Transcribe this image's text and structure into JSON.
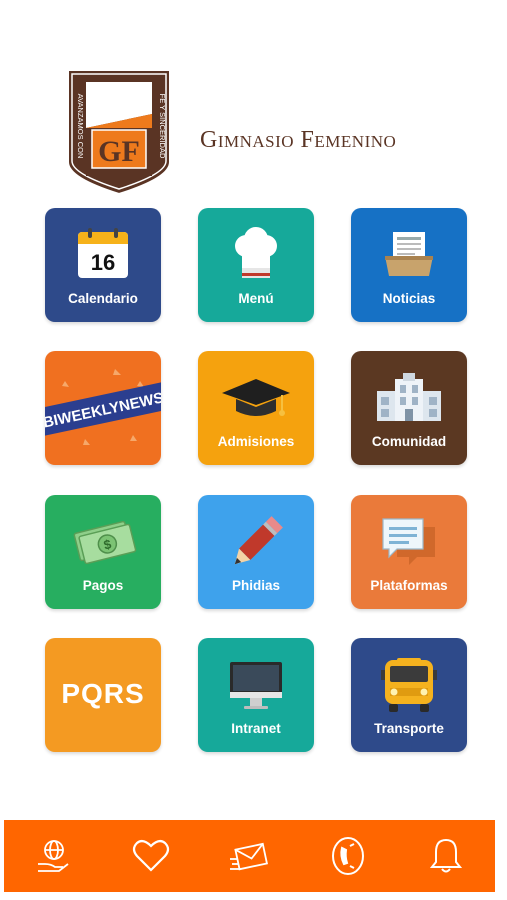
{
  "header": {
    "crest_left": "AVANZAMOS CON",
    "crest_right": "FE Y SINCERIDAD",
    "crest_monogram": "GF",
    "school_name": "Gimnasio Femenino"
  },
  "tiles": [
    {
      "label": "Calendario",
      "color": "#2e4a8a",
      "icon": "calendar-icon",
      "date": "16"
    },
    {
      "label": "Menú",
      "color": "#16a99a",
      "icon": "chef-hat-icon"
    },
    {
      "label": "Noticias",
      "color": "#1671c5",
      "icon": "news-tray-icon"
    },
    {
      "label": "BIWEEKLYNEWS",
      "color": "#f07020",
      "icon": "biweekly-news-banner"
    },
    {
      "label": "Admisiones",
      "color": "#f5a20e",
      "icon": "graduation-cap-icon"
    },
    {
      "label": "Comunidad",
      "color": "#5b3822",
      "icon": "building-icon"
    },
    {
      "label": "Pagos",
      "color": "#27ae60",
      "icon": "money-icon"
    },
    {
      "label": "Phidias",
      "color": "#3ea2ec",
      "icon": "pencil-icon"
    },
    {
      "label": "Plataformas",
      "color": "#ea7a3a",
      "icon": "chat-bubble-icon"
    },
    {
      "label": "PQRS",
      "color": "#f49a22",
      "icon": "pqrs-text"
    },
    {
      "label": "Intranet",
      "color": "#16a99a",
      "icon": "monitor-icon"
    },
    {
      "label": "Transporte",
      "color": "#2e4a8a",
      "icon": "school-bus-icon"
    }
  ],
  "bottom_nav": {
    "color": "#ff6600",
    "items": [
      "globe-hand-icon",
      "heart-icon",
      "mail-icon",
      "phone-icon",
      "bell-icon"
    ]
  }
}
